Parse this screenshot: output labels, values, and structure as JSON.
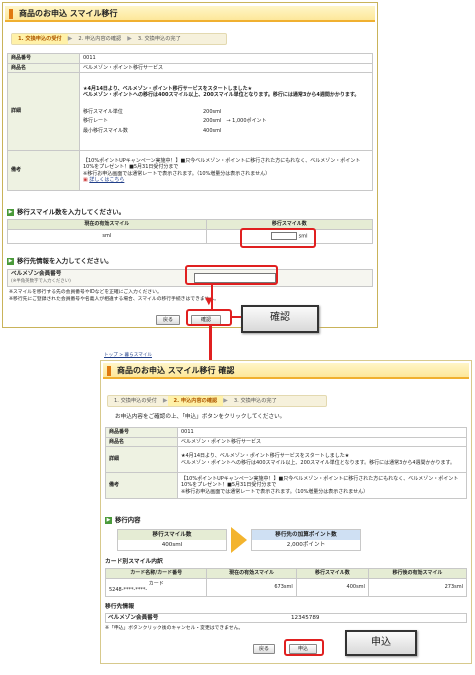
{
  "panel1": {
    "title": "商品のお申込 スマイル移行",
    "steps": [
      "1. 交換申込の受付",
      "2. 申込内容の確認",
      "3. 交換申込の完了"
    ],
    "info": {
      "product_no_label": "商品番号",
      "product_no": "0011",
      "product_name_label": "商品名",
      "product_name": "ベルメゾン・ポイント移行サービス",
      "detail_label": "詳細",
      "detail_text1": "★4月14日より、ベルメゾン・ポイント移行サービスをスタートしました★",
      "detail_text2": "ベルメゾン・ポイントへの移行は400スマイル以上、200スマイル単位となります。移行には通常3から4週間かかります。",
      "move_unit_label": "移行スマイル単位",
      "move_unit": "200sml",
      "rate_label": "移行レート",
      "rate": "200sml　→ 1,000ポイント",
      "min_label": "最小移行スマイル数",
      "min": "400sml",
      "notes_label": "備考",
      "notes_text": "【10%ポイントUPキャンペーン実施中！】■只今ベルメゾン・ポイントに移行された方にもれなく、ベルメゾン・ポイント10%をプレゼント！■5月31日受付分まで",
      "notes_text2": "※移行お申込画面では通常レートで表示されます。（10%増量分は表示されません）",
      "details_link": "詳しくはこちら"
    },
    "sec1_title": "移行スマイル数を入力してください。",
    "sec1_col1": "現在の有効スマイル",
    "sec1_col2": "移行スマイル数",
    "sec1_unit1": "sml",
    "sec1_unit2": "sml",
    "sec2_title": "移行先情報を入力してください。",
    "member_label": "ベルメゾン会員番号",
    "member_hint": "(※半角英数字で入力ください)",
    "note1": "※スマイルを移行する先の会員番号やIDなどを正確にご入力ください。",
    "note2": "※移行先にご登録された会員番号や名義人が相違する場合、スマイルの移行手続きはできません。",
    "back_button": "戻る",
    "confirm_button": "確認"
  },
  "callout1": "確認",
  "panel2": {
    "breadcrumb": "トップ > 暮らスマイル",
    "title": "商品のお申込 スマイル移行 確認",
    "steps": [
      "1. 交換申込の受付",
      "2. 申込内容の確認",
      "3. 交換申込の完了"
    ],
    "intro": "お申込内容をご確認の上、「申込」ボタンをクリックしてください。",
    "info": {
      "product_no_label": "商品番号",
      "product_no": "0011",
      "product_name_label": "商品名",
      "product_name": "ベルメゾン・ポイント移行サービス",
      "detail_label": "詳細",
      "detail_text1": "★4月14日より、ベルメゾン・ポイント移行サービスをスタートしました★",
      "detail_text2": "ベルメゾン・ポイントへの移行は400スマイル以上、200スマイル単位となります。移行には通常3から4週間かかります。",
      "notes_label": "備考",
      "notes_text": "【10%ポイントUPキャンペーン実施中！】■只今ベルメゾン・ポイントに移行された方にもれなく、ベルメゾン・ポイント10%をプレゼント！■5月31日受付分まで",
      "notes_text2": "※移行お申込画面では通常レートで表示されます。（10%増量分は表示されません）"
    },
    "sec_move": "移行内容",
    "move_col1": "移行スマイル数",
    "move_val1": "400sml",
    "move_col2": "移行先の加算ポイント数",
    "move_val2": "2,000ポイント",
    "sec_card": "カード別スマイル内訳",
    "card_headers": [
      "カード名称/カード番号",
      "現在の有効スマイル",
      "移行スマイル数",
      "移行後の有効スマイル"
    ],
    "card_name": "カード",
    "card_no": "5248-****-****-",
    "card_vals": [
      "673sml",
      "400sml",
      "273sml"
    ],
    "sec_dest": "移行先情報",
    "dest_label": "ベルメゾン会員番号",
    "dest_value": "12345789",
    "note": "※「申込」ボタンクリック後のキャンセル・変更はできません。",
    "back_button": "戻る",
    "apply_button": "申込"
  },
  "callout2": "申込"
}
